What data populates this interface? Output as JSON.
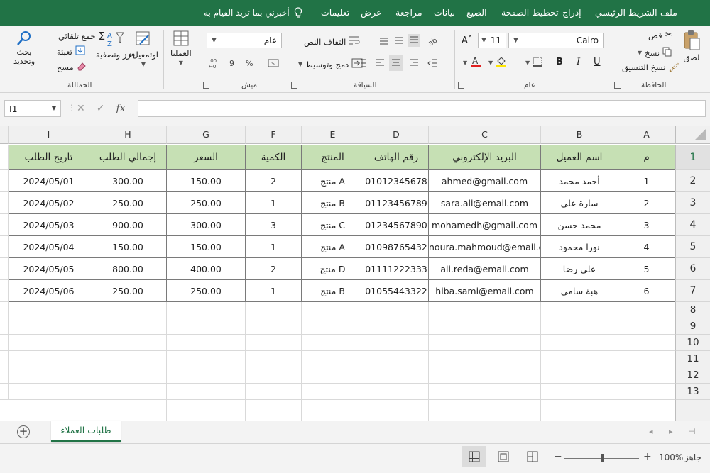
{
  "menu": {
    "tabs": [
      "ملف",
      "الشريط الرئيسي",
      "إدراج",
      "تخطيط الصفحة",
      "الصيغ",
      "بيانات",
      "مراجعة",
      "عرض",
      "تعليمات"
    ],
    "tell_me": "أخبرني بما تريد القيام به"
  },
  "ribbon": {
    "clipboard": {
      "paste": "لصق",
      "cut": "قص",
      "copy": "نسخ",
      "format_painter": "نسخ التنسيق",
      "label": "الحافظة"
    },
    "font": {
      "name": "Cairo",
      "size": "11",
      "label": "عام"
    },
    "alignment": {
      "wrap": "التفاف النص",
      "merge": "دمج وتوسيط",
      "label": "السياقة"
    },
    "number": {
      "format": "عام",
      "label": "ميش"
    },
    "cells": {
      "cells_btn": "العمليا"
    },
    "editing": {
      "autosum": "جمع تلقائي",
      "fill": "تعبئة",
      "clear": "مسح",
      "sort": "فرز وتصفية",
      "find": "بحث وتحديد",
      "ideas": "اوتمفيلء",
      "label": "الحماللة"
    }
  },
  "formula_bar": {
    "name_box": "I1",
    "fx": "fx",
    "value": ""
  },
  "grid": {
    "columns": [
      "A",
      "B",
      "C",
      "D",
      "E",
      "F",
      "G",
      "H",
      "I"
    ],
    "rows": [
      "1",
      "2",
      "3",
      "4",
      "5",
      "6",
      "7",
      "8",
      "9",
      "10",
      "11",
      "12",
      "13"
    ],
    "header": [
      "م",
      "اسم العميل",
      "البريد الإلكتروني",
      "رقم الهاتف",
      "المنتج",
      "الكمية",
      "السعر",
      "إجمالي الطلب",
      "تاريخ الطلب"
    ],
    "data": [
      [
        "1",
        "أحمد محمد",
        "ahmed@gmail.com",
        "01012345678",
        "منتج A",
        "2",
        "150.00",
        "300.00",
        "2024/05/01"
      ],
      [
        "2",
        "سارة علي",
        "sara.ali@email.com",
        "01123456789",
        "منتج B",
        "1",
        "250.00",
        "250.00",
        "2024/05/02"
      ],
      [
        "3",
        "محمد حسن",
        "mohamedh@gmail.com",
        "01234567890",
        "منتج C",
        "3",
        "300.00",
        "900.00",
        "2024/05/03"
      ],
      [
        "4",
        "نورا محمود",
        "noura.mahmoud@email.com",
        "01098765432",
        "منتج A",
        "1",
        "150.00",
        "150.00",
        "2024/05/04"
      ],
      [
        "5",
        "علي رضا",
        "ali.reda@email.com",
        "01111222333",
        "منتج D",
        "2",
        "400.00",
        "800.00",
        "2024/05/05"
      ],
      [
        "6",
        "هبة سامي",
        "hiba.sami@email.com",
        "01055443322",
        "منتج B",
        "1",
        "250.00",
        "250.00",
        "2024/05/06"
      ]
    ]
  },
  "sheets": {
    "active": "طلبات العملاء",
    "add": "+"
  },
  "status": {
    "ready": "جاهز",
    "zoom": "100%",
    "zoom_level": 0.5
  },
  "colors": {
    "accent": "#217346",
    "header_fill": "#c6e0b4"
  }
}
